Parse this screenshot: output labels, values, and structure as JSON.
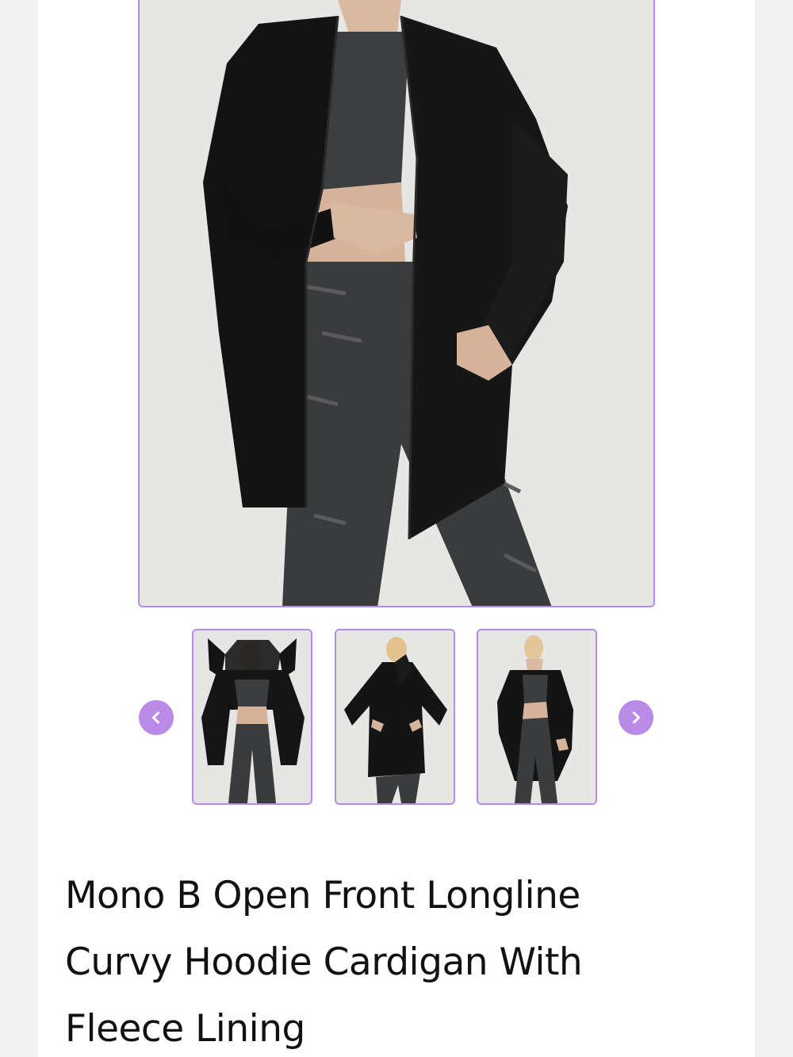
{
  "product": {
    "title": "Mono B Open Front Longline Curvy Hoodie Cardigan With Fleece Lining"
  },
  "gallery": {
    "main_image": "model-front-view-photo",
    "thumbnails": [
      {
        "image": "model-hood-up-photo",
        "selected": false
      },
      {
        "image": "model-back-view-photo",
        "selected": false
      },
      {
        "image": "model-front-pocket-photo",
        "selected": false
      }
    ],
    "prev_icon": "chevron-left-icon",
    "next_icon": "chevron-right-icon"
  },
  "colors": {
    "accent": "#b98ae6",
    "border": "#b48be6",
    "text": "#111111"
  }
}
